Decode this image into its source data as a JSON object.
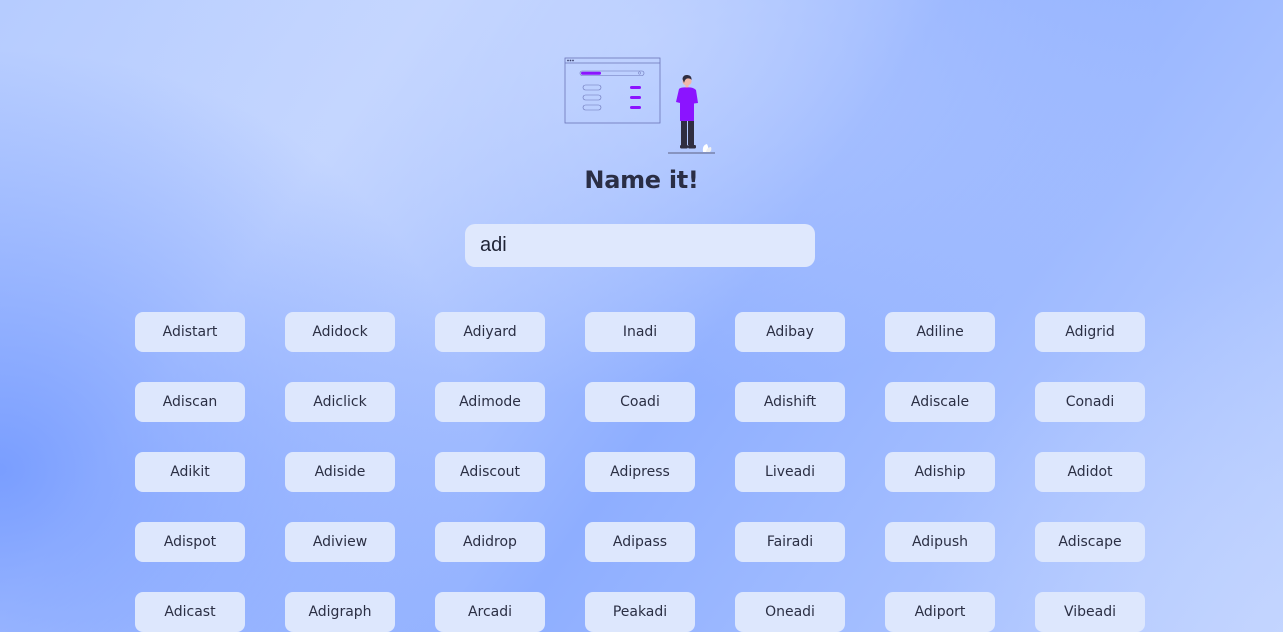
{
  "page": {
    "title": "Name it!"
  },
  "search": {
    "value": "adi"
  },
  "colors": {
    "accent": "#8b14ff",
    "text": "#2a2e45",
    "chip_bg": "#dde7fd"
  },
  "icons": {
    "hero": "person-browsing-window-illustration"
  },
  "names": [
    "Adistart",
    "Adidock",
    "Adiyard",
    "Inadi",
    "Adibay",
    "Adiline",
    "Adigrid",
    "Adiscan",
    "Adiclick",
    "Adimode",
    "Coadi",
    "Adishift",
    "Adiscale",
    "Conadi",
    "Adikit",
    "Adiside",
    "Adiscout",
    "Adipress",
    "Liveadi",
    "Adiship",
    "Adidot",
    "Adispot",
    "Adiview",
    "Adidrop",
    "Adipass",
    "Fairadi",
    "Adipush",
    "Adiscape",
    "Adicast",
    "Adigraph",
    "Arcadi",
    "Peakadi",
    "Oneadi",
    "Adiport",
    "Vibeadi"
  ]
}
